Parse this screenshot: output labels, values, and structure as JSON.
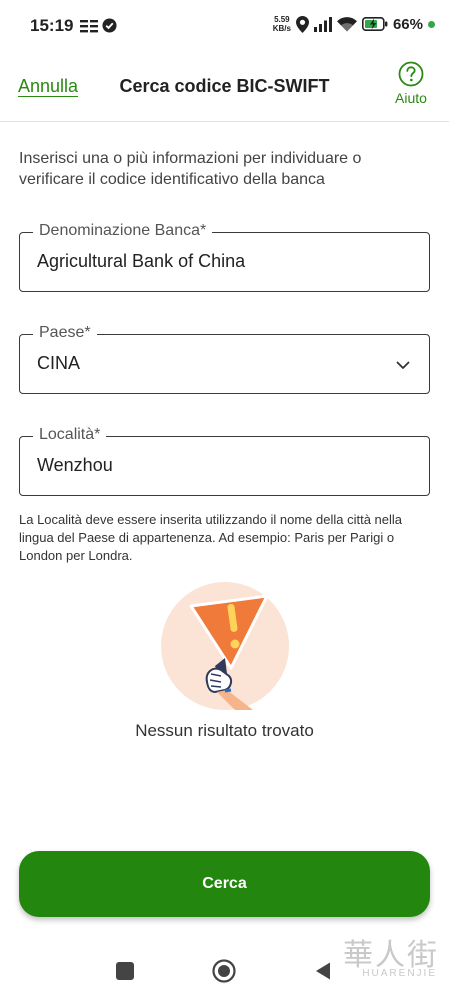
{
  "status_bar": {
    "time": "15:19",
    "net_speed_value": "5.59",
    "net_speed_unit": "KB/s",
    "battery_pct": "66%"
  },
  "header": {
    "cancel_label": "Annulla",
    "title": "Cerca codice BIC-SWIFT",
    "help_label": "Aiuto"
  },
  "intro": "Inserisci una o più informazioni per individuare o verificare il codice identificativo della banca",
  "form": {
    "bank": {
      "label": "Denominazione Banca*",
      "value": "Agricultural Bank of China"
    },
    "country": {
      "label": "Paese*",
      "value": "CINA"
    },
    "city": {
      "label": "Località*",
      "value": "Wenzhou"
    }
  },
  "helper_text": "La Località deve essere inserita utilizzando il nome della città nella lingua del Paese di appartenenza. Ad esempio: Paris per Parigi o London per Londra.",
  "empty_state": "Nessun risultato trovato",
  "search_button_label": "Cerca",
  "watermark": {
    "main": "華人街",
    "sub": "HUARENJIE"
  },
  "colors": {
    "accent": "#23870f",
    "link": "#2a8a12",
    "warning": "#f07a3a"
  }
}
